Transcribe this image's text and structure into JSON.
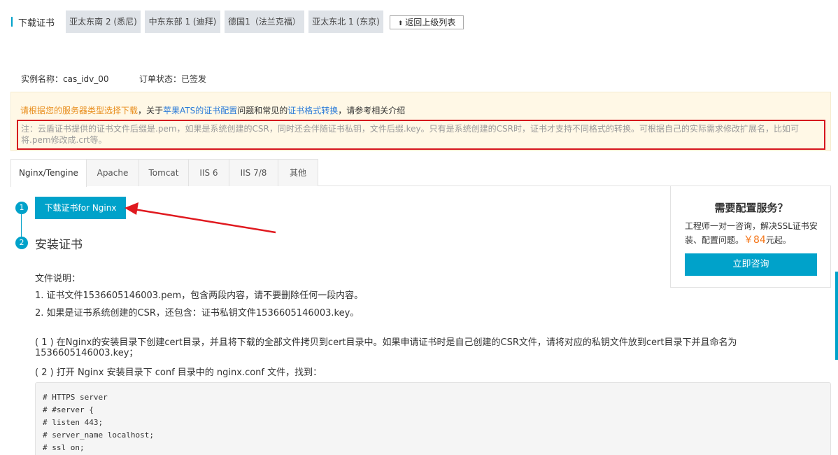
{
  "header": {
    "title": "下载证书",
    "region_tabs": [
      "亚太东南 2 (悉尼)",
      "中东东部 1 (迪拜)",
      "德国1（法兰克福）",
      "亚太东北 1 (东京)"
    ],
    "back_label": "返回上级列表"
  },
  "instance": {
    "name": "实例名称：cas_idv_00",
    "status": "订单状态：已签发"
  },
  "notice": {
    "part1": "请根据您的服务器类型选择下载",
    "part2": "，关于",
    "link1": "苹果ATS的证书配置",
    "part3": "问题和常见的",
    "link2": "证书格式转换",
    "part4": "，请参考相关介绍",
    "note": "注：云盾证书提供的证书文件后缀是.pem，如果是系统创建的CSR，同时还会伴随证书私钥，文件后缀.key。只有是系统创建的CSR时，证书才支持不同格式的转换。可根据自己的实际需求修改扩展名，比如可将.pem修改成.crt等。"
  },
  "server_tabs": [
    "Nginx/Tengine",
    "Apache",
    "Tomcat",
    "IIS 6",
    "IIS 7/8",
    "其他"
  ],
  "steps": {
    "step1_num": "1",
    "step2_num": "2",
    "download_label": "下载证书for Nginx",
    "install_title": "安装证书"
  },
  "content": {
    "files_heading": "文件说明：",
    "file1": "1. 证书文件1536605146003.pem，包含两段内容，请不要删除任何一段内容。",
    "file2": "2. 如果是证书系统创建的CSR，还包含：证书私钥文件1536605146003.key。",
    "step_a": "( 1 ) 在Nginx的安装目录下创建cert目录，并且将下载的全部文件拷贝到cert目录中。如果申请证书时是自己创建的CSR文件，请将对应的私钥文件放到cert目录下并且命名为1536605146003.key；",
    "step_b": "( 2 ) 打开 Nginx 安装目录下 conf 目录中的 nginx.conf 文件，找到：",
    "code_lines": [
      "# HTTPS server",
      "# #server {",
      "# listen 443;",
      "# server_name localhost;",
      "# ssl on;"
    ]
  },
  "side": {
    "title": "需要配置服务？",
    "desc": "工程师一对一咨询，解决SSL证书安装、配置问题。",
    "price": "￥84",
    "price_suffix": "元起。",
    "button": "立即咨询"
  },
  "colors": {
    "accent": "#00a2ca",
    "highlight_border": "#d6151d",
    "notice_orange": "#e88c1a",
    "link_blue": "#2a7ad8",
    "price_orange": "#f5771a"
  }
}
